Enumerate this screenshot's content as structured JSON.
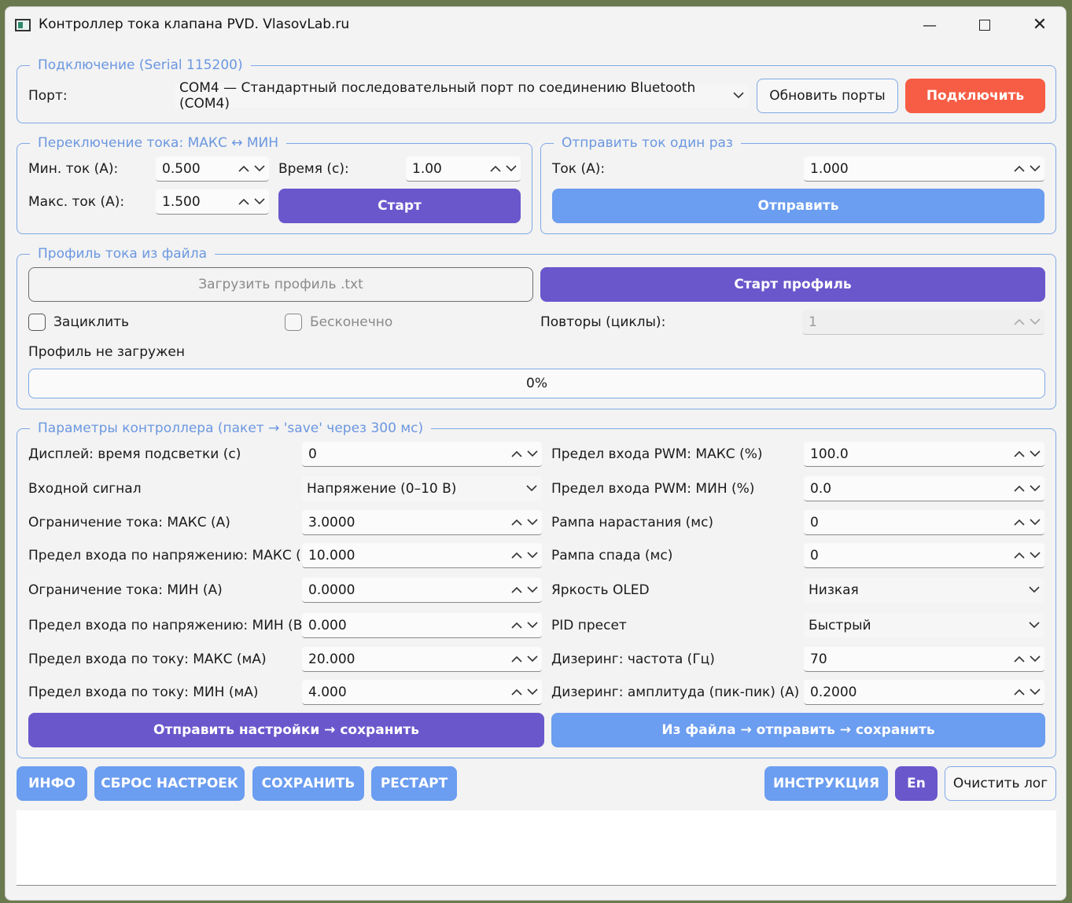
{
  "window": {
    "title": "Контроллер тока клапана PVD. VlasovLab.ru",
    "minimize": "—",
    "close": "✕"
  },
  "connection": {
    "title": "Подключение (Serial 115200)",
    "port_label": "Порт:",
    "port_value": "COM4 — Стандартный последовательный порт по соединению Bluetooth (COM4)",
    "refresh_label": "Обновить порты",
    "connect_label": "Подключить"
  },
  "switching": {
    "title": "Переключение тока: МАКС ↔ МИН",
    "min_label": "Мин. ток (А):",
    "min_value": "0.500",
    "max_label": "Макс. ток (А):",
    "max_value": "1.500",
    "time_label": "Время (с):",
    "time_value": "1.00",
    "start_label": "Старт"
  },
  "send_once": {
    "title": "Отправить ток один раз",
    "current_label": "Ток (А):",
    "current_value": "1.000",
    "send_label": "Отправить"
  },
  "profile": {
    "title": "Профиль тока из файла",
    "load_label": "Загрузить профиль .txt",
    "start_label": "Старт профиль",
    "loop_label": "Зациклить",
    "infinite_label": "Бесконечно",
    "repeats_label": "Повторы (циклы):",
    "repeats_value": "1",
    "status": "Профиль не загружен",
    "progress": "0%"
  },
  "params": {
    "title": "Параметры контроллера (пакет → 'save' через 300 мс)",
    "left": [
      {
        "label": "Дисплей: время подсветки (с)",
        "value": "0",
        "kind": "spin"
      },
      {
        "label": "Входной сигнал",
        "value": "Напряжение (0–10 В)",
        "kind": "combo"
      },
      {
        "label": "Ограничение тока: МАКС (А)",
        "value": "3.0000",
        "kind": "spin"
      },
      {
        "label": "Предел входа по напряжению: МАКС (В)",
        "value": "10.000",
        "kind": "spin"
      },
      {
        "label": "Ограничение тока: МИН (А)",
        "value": "0.0000",
        "kind": "spin"
      },
      {
        "label": "Предел входа по напряжению: МИН (В)",
        "value": "0.000",
        "kind": "spin"
      },
      {
        "label": "Предел входа по току: МАКС (мА)",
        "value": "20.000",
        "kind": "spin"
      },
      {
        "label": "Предел входа по току: МИН (мА)",
        "value": "4.000",
        "kind": "spin"
      }
    ],
    "right": [
      {
        "label": "Предел входа PWM: МАКС (%)",
        "value": "100.0",
        "kind": "spin"
      },
      {
        "label": "Предел входа PWM: МИН (%)",
        "value": "0.0",
        "kind": "spin"
      },
      {
        "label": "Рампа нарастания (мс)",
        "value": "0",
        "kind": "spin"
      },
      {
        "label": "Рампа спада (мс)",
        "value": "0",
        "kind": "spin"
      },
      {
        "label": "Яркость OLED",
        "value": "Низкая",
        "kind": "combo"
      },
      {
        "label": "PID пресет",
        "value": "Быстрый",
        "kind": "combo"
      },
      {
        "label": "Дизеринг: частота (Гц)",
        "value": "70",
        "kind": "spin"
      },
      {
        "label": "Дизеринг: амплитуда (пик-пик) (А)",
        "value": "0.2000",
        "kind": "spin"
      }
    ],
    "send_save_label": "Отправить настройки → сохранить",
    "file_send_save_label": "Из файла → отправить → сохранить"
  },
  "bottom": {
    "info_label": "ИНФО",
    "reset_label": "СБРОС НАСТРОЕК",
    "save_label": "СОХРАНИТЬ",
    "restart_label": "РЕСТАРТ",
    "manual_label": "ИНСТРУКЦИЯ",
    "lang_label": "En",
    "clear_log_label": "Очистить лог"
  },
  "colors": {
    "accent_purple": "#6a57cc",
    "accent_blue": "#6b9df0",
    "accent_red": "#f75d45",
    "group_border": "#7ea8e6"
  }
}
